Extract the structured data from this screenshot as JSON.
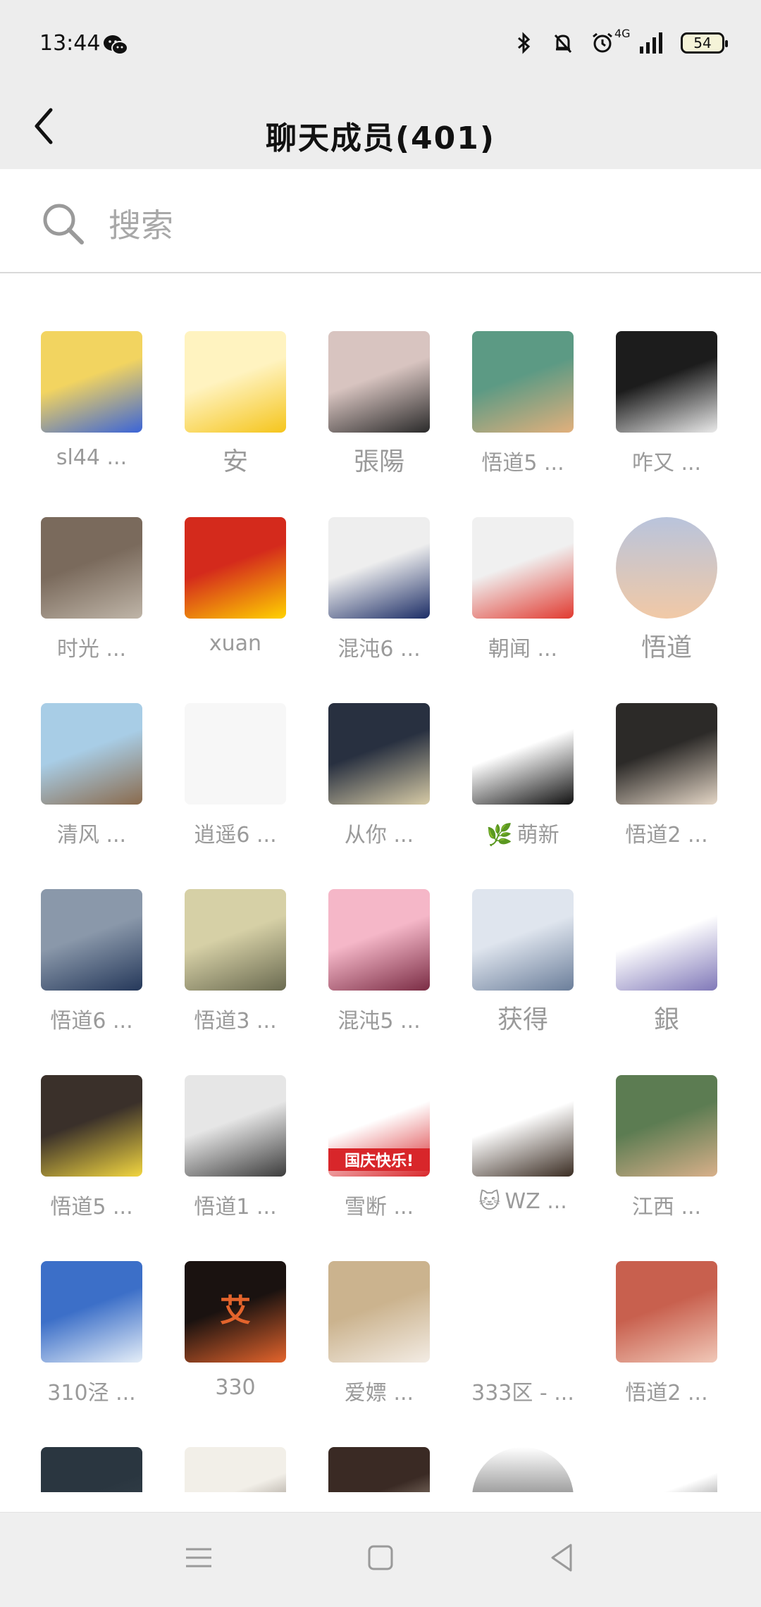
{
  "status_bar": {
    "time": "13:44",
    "network": "4G",
    "battery": "54",
    "icons": [
      "wechat-icon",
      "bluetooth-icon",
      "mute-bell-icon",
      "alarm-icon",
      "signal-icon",
      "battery-icon"
    ]
  },
  "header": {
    "title": "聊天成员(401)",
    "back_icon": "chevron-left-icon"
  },
  "search": {
    "placeholder": "搜索",
    "icon": "search-icon"
  },
  "members": [
    {
      "name": "sl44 ...",
      "avatar": "cartoon-dog-newspaper",
      "colors": [
        "#f2d460",
        "#3a64d8"
      ]
    },
    {
      "name": "安",
      "avatar": "anime-boy-pikachu-hood",
      "colors": [
        "#fff3c0",
        "#f5c51c"
      ]
    },
    {
      "name": "張陽",
      "avatar": "silhouette-sunset",
      "colors": [
        "#d8c4c0",
        "#2a2a2a"
      ]
    },
    {
      "name": "悟道5 ...",
      "avatar": "cat-holding-paper",
      "colors": [
        "#5c9a84",
        "#e2b07c"
      ]
    },
    {
      "name": "咋又 ...",
      "avatar": "dark-sketch",
      "colors": [
        "#1c1c1c",
        "#eaeaea"
      ]
    },
    {
      "name": "时光 ...",
      "avatar": "street-artist",
      "colors": [
        "#7a6a5c",
        "#bfb5a8"
      ]
    },
    {
      "name": "xuan",
      "avatar": "flag-portrait",
      "colors": [
        "#d42a1c",
        "#ffd200"
      ]
    },
    {
      "name": "混沌6 ...",
      "avatar": "stripes-bag",
      "colors": [
        "#eeeeee",
        "#1c2d66"
      ]
    },
    {
      "name": "朝闻 ...",
      "avatar": "cartoon-boy-peace",
      "colors": [
        "#f0f0f0",
        "#e13a30"
      ]
    },
    {
      "name": "悟道",
      "avatar": "tree-twilight",
      "colors": [
        "#b9c4dc",
        "#f1c9a6"
      ]
    },
    {
      "name": "清风 ...",
      "avatar": "mountain-statue",
      "colors": [
        "#a8cde6",
        "#8a6a4c"
      ]
    },
    {
      "name": "逍遥6 ...",
      "avatar": "blank",
      "colors": [
        "#f7f7f7",
        "#f7f7f7"
      ]
    },
    {
      "name": "从你 ...",
      "avatar": "moon-night",
      "colors": [
        "#283040",
        "#d7cba6"
      ]
    },
    {
      "name": "萌新",
      "emoji": "🌿",
      "avatar": "samurai-silhouette",
      "colors": [
        "#ffffff",
        "#111111"
      ]
    },
    {
      "name": "悟道2 ...",
      "avatar": "white-dog",
      "colors": [
        "#2c2a28",
        "#e4d6c6"
      ]
    },
    {
      "name": "悟道6 ...",
      "avatar": "mount-fuji",
      "colors": [
        "#8a98aa",
        "#25385a"
      ]
    },
    {
      "name": "悟道3 ...",
      "avatar": "vintage-clouds",
      "colors": [
        "#d6d0a6",
        "#6a6a50"
      ]
    },
    {
      "name": "混沌5 ...",
      "avatar": "two-kids",
      "colors": [
        "#f5b7c8",
        "#7a2c44"
      ]
    },
    {
      "name": "获得",
      "avatar": "hand-jacket",
      "colors": [
        "#dfe5ee",
        "#6b7e9a"
      ]
    },
    {
      "name": "銀",
      "avatar": "anime-sketch-face",
      "colors": [
        "#ffffff",
        "#8078b8"
      ]
    },
    {
      "name": "悟道5 ...",
      "avatar": "pikachu-costume",
      "colors": [
        "#3a302a",
        "#f2d640"
      ]
    },
    {
      "name": "悟道1 ...",
      "avatar": "manga-girl",
      "colors": [
        "#e6e6e6",
        "#3c3c3c"
      ]
    },
    {
      "name": "雪断 ...",
      "avatar": "national-day",
      "colors": [
        "#ffffff",
        "#d8262a"
      ],
      "badge_text": "国庆快乐!"
    },
    {
      "name": "WZ ...",
      "emoji": "🐱",
      "avatar": "messy-hair-doodle",
      "colors": [
        "#ffffff",
        "#3a2c22"
      ]
    },
    {
      "name": "江西 ...",
      "avatar": "green-hair-anime",
      "colors": [
        "#5c7c52",
        "#d8b08a"
      ]
    },
    {
      "name": "310泾 ...",
      "avatar": "blue-sky-clouds",
      "colors": [
        "#3c6fc8",
        "#e5eef8"
      ]
    },
    {
      "name": "330",
      "avatar": "emblem-dark",
      "colors": [
        "#1a1210",
        "#e4642c"
      ],
      "badge_text": "艾"
    },
    {
      "name": "爱嫖 ...",
      "avatar": "white-duck",
      "colors": [
        "#cbb38e",
        "#f3ece4"
      ]
    },
    {
      "name": "333区 - ...",
      "avatar": "blank",
      "colors": [
        "#ffffff",
        "#ffffff"
      ]
    },
    {
      "name": "悟道2 ...",
      "avatar": "anime-girl-fox-mask",
      "colors": [
        "#c8604e",
        "#f1c8b8"
      ]
    },
    {
      "name": "",
      "avatar": "dark-landscape",
      "colors": [
        "#2a3640",
        "#3c4850"
      ]
    },
    {
      "name": "",
      "avatar": "glasses-girl",
      "colors": [
        "#f2efe8",
        "#4a3c30"
      ]
    },
    {
      "name": "",
      "avatar": "straw-hat-dog",
      "colors": [
        "#3a2a24",
        "#e8d8c2"
      ]
    },
    {
      "name": "",
      "avatar": "round-dark-portrait",
      "colors": [
        "#ffffff",
        "#2a2a2a"
      ]
    },
    {
      "name": "",
      "avatar": "anime-sketch-girl",
      "colors": [
        "#ffffff",
        "#222222"
      ]
    }
  ],
  "nav": {
    "icons": [
      "menu-icon",
      "home-square-icon",
      "back-triangle-icon"
    ]
  }
}
